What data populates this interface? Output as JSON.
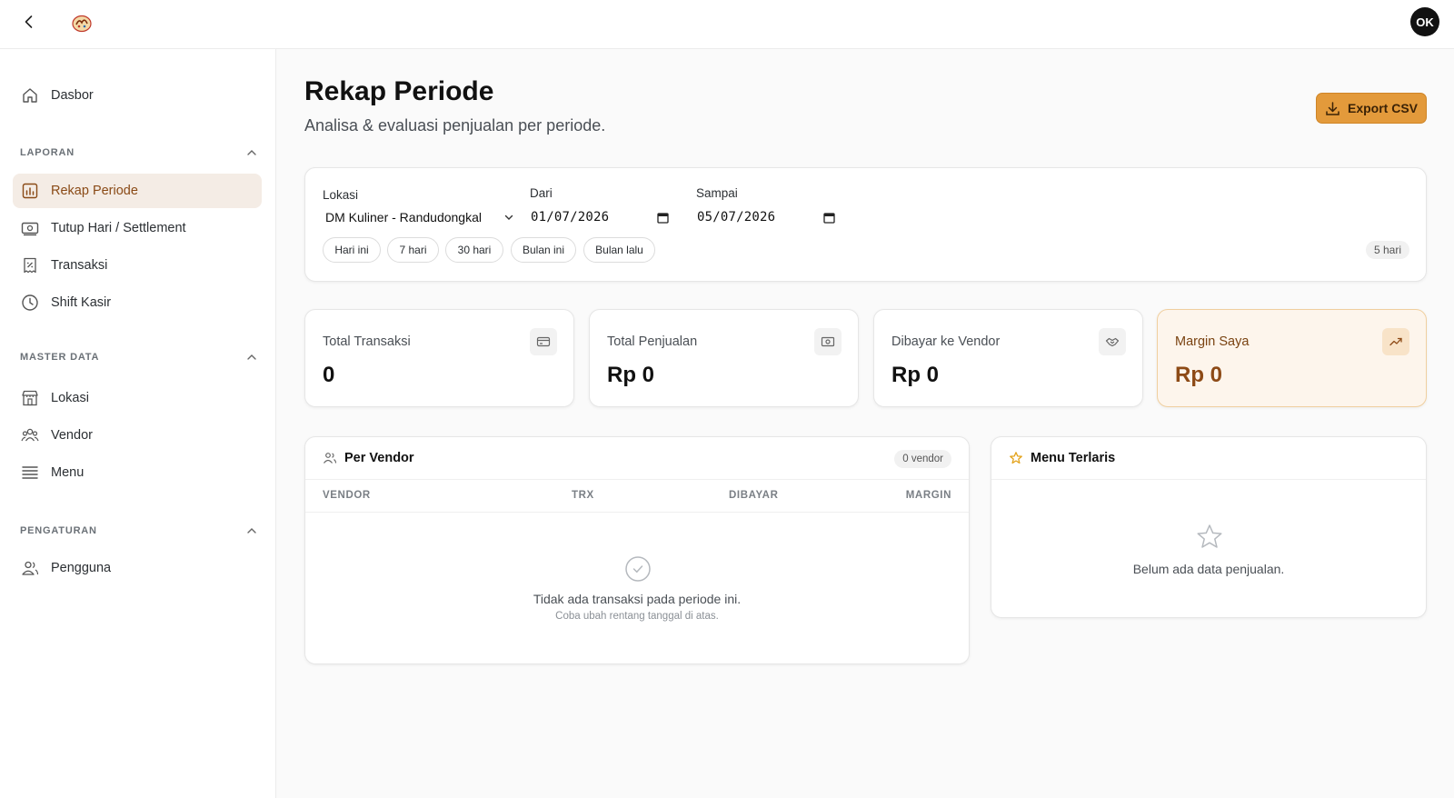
{
  "topbar": {
    "avatar_initials": "OK"
  },
  "sidebar": {
    "dashboard_label": "Dasbor",
    "sections": [
      {
        "title": "LAPORAN",
        "items": [
          "Rekap Periode",
          "Tutup Hari / Settlement",
          "Transaksi",
          "Shift Kasir"
        ]
      },
      {
        "title": "MASTER DATA",
        "items": [
          "Lokasi",
          "Vendor",
          "Menu"
        ]
      },
      {
        "title": "PENGATURAN",
        "items": [
          "Pengguna"
        ]
      }
    ],
    "active_item": "Rekap Periode"
  },
  "page": {
    "title": "Rekap Periode",
    "subtitle": "Analisa & evaluasi penjualan per periode.",
    "export_label": "Export CSV"
  },
  "filter": {
    "location_label": "Lokasi",
    "location_value": "DM Kuliner - Randudongkal",
    "from_label": "Dari",
    "from_value": "01/07/2026",
    "to_label": "Sampai",
    "to_value": "05/07/2026",
    "presets": [
      "Hari ini",
      "7 hari",
      "30 hari",
      "Bulan ini",
      "Bulan lalu"
    ],
    "days_badge": "5 hari"
  },
  "stats": [
    {
      "label": "Total Transaksi",
      "value": "0",
      "icon": "card-icon"
    },
    {
      "label": "Total Penjualan",
      "value": "Rp 0",
      "icon": "cash-icon"
    },
    {
      "label": "Dibayar ke Vendor",
      "value": "Rp 0",
      "icon": "handshake-icon"
    },
    {
      "label": "Margin Saya",
      "value": "Rp 0",
      "icon": "trend-up-icon"
    }
  ],
  "vendor_table": {
    "title": "Per Vendor",
    "count_badge": "0 vendor",
    "columns": [
      "VENDOR",
      "TRX",
      "DIBAYAR",
      "MARGIN"
    ],
    "empty_title": "Tidak ada transaksi pada periode ini.",
    "empty_hint": "Coba ubah rentang tanggal di atas."
  },
  "top_menu": {
    "title": "Menu Terlaris",
    "empty_text": "Belum ada data penjualan."
  },
  "colors": {
    "accent": "#e39a3b",
    "accent_text": "#8d4a16",
    "active_bg": "#f4ece5"
  }
}
